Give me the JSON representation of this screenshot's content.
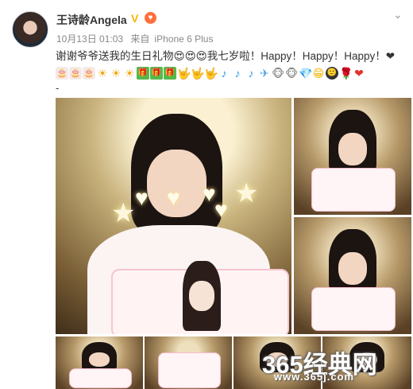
{
  "post": {
    "username": "王诗龄Angela",
    "date": "10月13日 01:03",
    "source_prefix": "来自",
    "source_device": "iPhone 6 Plus",
    "text": "谢谢爷爷送我的生日礼物😍😍😍我七岁啦！Happy！Happy！Happy！❤",
    "emoji_row": [
      "🎂",
      "🎂",
      "🎂",
      "☀",
      "☀",
      "☀",
      "🎁",
      "🎁",
      "🎁",
      "🤟",
      "🤟",
      "🤟",
      "♪",
      "♪",
      "♪",
      "✈",
      "🐵",
      "🐵",
      "💎",
      "😁",
      "🙂",
      "🌹",
      "❤"
    ],
    "continuation": "-"
  },
  "watermark": {
    "main": "365经典网",
    "url": "www.365j.com"
  },
  "colors": {
    "username": "#333333",
    "meta": "#888888",
    "verified": "#f7b500"
  }
}
